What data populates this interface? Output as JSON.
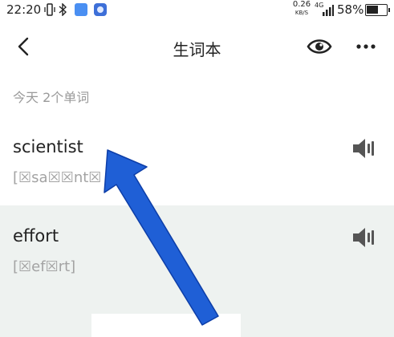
{
  "status_bar": {
    "time": "22:20",
    "net_speed_value": "0.26",
    "net_speed_unit": "KB/S",
    "network_type": "4G",
    "battery_percent": "58%",
    "battery_level": 0.58
  },
  "nav": {
    "title": "生词本"
  },
  "section": {
    "header": "今天 2个单词"
  },
  "words": [
    {
      "word": "scientist",
      "phonetic": "[☒sa☒☒nt☒"
    },
    {
      "word": "effort",
      "phonetic": "[☒ef☒rt]"
    }
  ],
  "colors": {
    "background": "#f3f5f4",
    "arrow": "#1f5fd6"
  },
  "icons": [
    "back-icon",
    "eye-icon",
    "more-icon",
    "speaker-icon"
  ]
}
